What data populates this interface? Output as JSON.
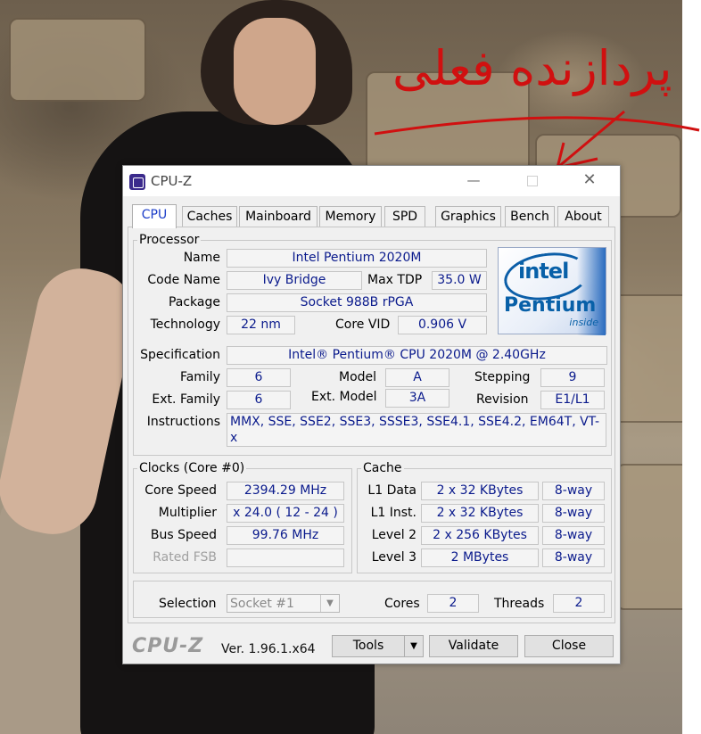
{
  "annotation": {
    "text": "پردازنده فعلی",
    "color": "#d01010"
  },
  "window": {
    "title": "CPU-Z",
    "controls": {
      "minimize": "—",
      "close": "✕"
    }
  },
  "tabs": [
    "CPU",
    "Caches",
    "Mainboard",
    "Memory",
    "SPD",
    "Graphics",
    "Bench",
    "About"
  ],
  "active_tab": "CPU",
  "processor": {
    "legend": "Processor",
    "name_label": "Name",
    "name": "Intel Pentium 2020M",
    "codename_label": "Code Name",
    "codename": "Ivy Bridge",
    "maxtdp_label": "Max TDP",
    "maxtdp": "35.0 W",
    "package_label": "Package",
    "package": "Socket 988B rPGA",
    "technology_label": "Technology",
    "technology": "22 nm",
    "corevid_label": "Core VID",
    "corevid": "0.906 V",
    "specification_label": "Specification",
    "specification": "Intel® Pentium® CPU 2020M @ 2.40GHz",
    "family_label": "Family",
    "family": "6",
    "model_label": "Model",
    "model": "A",
    "stepping_label": "Stepping",
    "stepping": "9",
    "extfamily_label": "Ext. Family",
    "extfamily": "6",
    "extmodel_label": "Ext. Model",
    "extmodel": "3A",
    "revision_label": "Revision",
    "revision": "E1/L1",
    "instructions_label": "Instructions",
    "instructions": "MMX, SSE, SSE2, SSE3, SSSE3, SSE4.1, SSE4.2, EM64T, VT-x"
  },
  "logo": {
    "brand": "intel",
    "product": "Pentium",
    "tag": "inside"
  },
  "clocks": {
    "legend": "Clocks (Core #0)",
    "corespeed_label": "Core Speed",
    "corespeed": "2394.29 MHz",
    "multiplier_label": "Multiplier",
    "multiplier": "x 24.0 ( 12 - 24 )",
    "busspeed_label": "Bus Speed",
    "busspeed": "99.76 MHz",
    "ratedfsb_label": "Rated FSB",
    "ratedfsb": ""
  },
  "cache": {
    "legend": "Cache",
    "rows": [
      {
        "label": "L1 Data",
        "size": "2 x 32 KBytes",
        "way": "8-way"
      },
      {
        "label": "L1 Inst.",
        "size": "2 x 32 KBytes",
        "way": "8-way"
      },
      {
        "label": "Level 2",
        "size": "2 x 256 KBytes",
        "way": "8-way"
      },
      {
        "label": "Level 3",
        "size": "2 MBytes",
        "way": "8-way"
      }
    ]
  },
  "selection": {
    "label": "Selection",
    "value": "Socket #1",
    "cores_label": "Cores",
    "cores": "2",
    "threads_label": "Threads",
    "threads": "2"
  },
  "footer": {
    "brand": "CPU-Z",
    "version": "Ver. 1.96.1.x64",
    "tools_label": "Tools",
    "validate_label": "Validate",
    "close_label": "Close"
  }
}
